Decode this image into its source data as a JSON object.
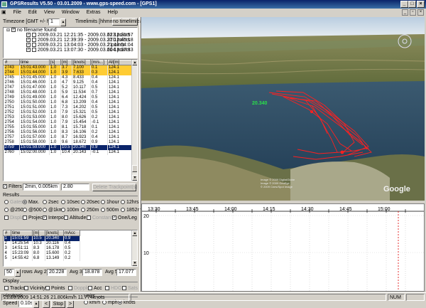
{
  "window": {
    "title": "GPSResults V5.50 - 03.01.2009 - www.gps-speed.com - [GPS1]"
  },
  "menu": [
    "File",
    "Edit",
    "View",
    "Window",
    "Extras",
    "Help"
  ],
  "header": {
    "timezone_label": "Timezone [GMT +/- h]:",
    "timezone_value": "1",
    "timelimits_label": "Timelimits [hhmm]",
    "timelimits_button": "no timelimits"
  },
  "files": {
    "root_label": "no filename found",
    "items": [
      {
        "label": "2009.03.21 12:21:35 - 2009.03.21 12:31:57",
        "points": "623 points"
      },
      {
        "label": "2009.03.21 12:39:39 - 2009.03.21 12:45:18",
        "points": "370 points"
      },
      {
        "label": "2009.03.21 13:04:03 - 2009.03.21 13:04:04",
        "points": "2 points"
      },
      {
        "label": "2009.03.21 13:07:30 - 2009.03.21 13:17:33",
        "points": "604 points"
      }
    ]
  },
  "points_table": {
    "columns": [
      "#",
      "time",
      "[s]",
      "[m]",
      "[knots]",
      "[m/s...]",
      "Alt[m]"
    ],
    "rows": [
      {
        "n": "2743",
        "time": "15:01:43.000",
        "s": "1.0",
        "m": "3.7",
        "kn": "7.100",
        "ms": "0.1",
        "alt": "124.1",
        "state": "hl"
      },
      {
        "n": "2744",
        "time": "15:01:44.000",
        "s": "1.0",
        "m": "3.9",
        "kn": "7.633",
        "ms": "0.3",
        "alt": "124.1",
        "state": "hl"
      },
      {
        "n": "2745",
        "time": "15:01:45.000",
        "s": "1.0",
        "m": "4.3",
        "kn": "8.433",
        "ms": "0.4",
        "alt": "124.1",
        "state": ""
      },
      {
        "n": "2746",
        "time": "15:01:46.000",
        "s": "1.0",
        "m": "4.7",
        "kn": "9.125",
        "ms": "0.4",
        "alt": "124.1",
        "state": ""
      },
      {
        "n": "2747",
        "time": "15:01:47.000",
        "s": "1.0",
        "m": "5.2",
        "kn": "10.117",
        "ms": "0.5",
        "alt": "124.1",
        "state": ""
      },
      {
        "n": "2748",
        "time": "15:01:48.000",
        "s": "1.0",
        "m": "5.9",
        "kn": "11.534",
        "ms": "0.7",
        "alt": "124.1",
        "state": ""
      },
      {
        "n": "2749",
        "time": "15:01:49.000",
        "s": "1.0",
        "m": "6.4",
        "kn": "12.424",
        "ms": "0.5",
        "alt": "124.1",
        "state": ""
      },
      {
        "n": "2750",
        "time": "15:01:50.000",
        "s": "1.0",
        "m": "6.8",
        "kn": "13.209",
        "ms": "0.4",
        "alt": "124.1",
        "state": ""
      },
      {
        "n": "2751",
        "time": "15:01:51.000",
        "s": "1.0",
        "m": "7.3",
        "kn": "14.202",
        "ms": "0.5",
        "alt": "124.1",
        "state": ""
      },
      {
        "n": "2752",
        "time": "15:01:52.000",
        "s": "1.0",
        "m": "7.9",
        "kn": "15.321",
        "ms": "0.5",
        "alt": "124.1",
        "state": ""
      },
      {
        "n": "2753",
        "time": "15:01:53.000",
        "s": "1.0",
        "m": "8.0",
        "kn": "15.626",
        "ms": "0.2",
        "alt": "124.1",
        "state": ""
      },
      {
        "n": "2754",
        "time": "15:01:54.000",
        "s": "1.0",
        "m": "7.9",
        "kn": "15.454",
        "ms": "-0.1",
        "alt": "124.1",
        "state": ""
      },
      {
        "n": "2755",
        "time": "15:01:55.000",
        "s": "1.0",
        "m": "8.1",
        "kn": "15.718",
        "ms": "0.1",
        "alt": "124.1",
        "state": ""
      },
      {
        "n": "2756",
        "time": "15:01:56.000",
        "s": "1.0",
        "m": "8.3",
        "kn": "16.106",
        "ms": "0.2",
        "alt": "124.1",
        "state": ""
      },
      {
        "n": "2757",
        "time": "15:01:57.000",
        "s": "1.0",
        "m": "8.7",
        "kn": "16.923",
        "ms": "0.4",
        "alt": "124.1",
        "state": ""
      },
      {
        "n": "2758",
        "time": "15:01:58.000",
        "s": "1.0",
        "m": "9.6",
        "kn": "18.672",
        "ms": "0.9",
        "alt": "124.1",
        "state": ""
      },
      {
        "n": "2759",
        "time": "15:01:59.000",
        "s": "1.0",
        "m": "10.5",
        "kn": "20.340",
        "ms": "0.9",
        "alt": "124.1",
        "state": "sel"
      },
      {
        "n": "2760",
        "time": "15:02:00.000",
        "s": "1.0",
        "m": "10.4",
        "kn": "20.143",
        "ms": "-0.1",
        "alt": "124.1",
        "state": ""
      }
    ]
  },
  "filters": {
    "label": "Filters",
    "value": "2min, 0.005km",
    "value2": "2.80",
    "delete_button": "Delete Trackpoint(s)"
  },
  "results": {
    "title": "Results",
    "row1": [
      "Gates",
      "Max.",
      "2sec",
      "10sec",
      "20sec",
      "1hour",
      "12hrs"
    ],
    "row2": [
      "@250",
      "@500",
      "@1km",
      "100m",
      "250m",
      "500m",
      "1852m"
    ],
    "row3": [
      "Display",
      "Project",
      "Interpol",
      "Altitude",
      "Constant",
      "One/Leg"
    ]
  },
  "results_table": {
    "columns": [
      "#",
      "time",
      "[m]",
      "[knots]",
      "mAcc"
    ],
    "rows": [
      {
        "n": "1",
        "time": "15:01:59",
        "m": "10.5",
        "kn": "20.340",
        "acc": "0.9",
        "state": "sel"
      },
      {
        "n": "2",
        "time": "14:25:54",
        "m": "10.3",
        "kn": "20.116",
        "acc": "0.4",
        "state": ""
      },
      {
        "n": "3",
        "time": "14:51:11",
        "m": "8.3",
        "kn": "16.178",
        "acc": "0.5",
        "state": ""
      },
      {
        "n": "4",
        "time": "15:23:09",
        "m": "8.0",
        "kn": "15.600",
        "acc": "0.2",
        "state": ""
      },
      {
        "n": "5",
        "time": "14:55:42",
        "m": "6.8",
        "kn": "13.149",
        "acc": "0.2",
        "state": ""
      }
    ]
  },
  "rows_bar": {
    "rows_value": "50",
    "rows_label": "rows",
    "avg2_label": "Avg 2:",
    "avg2_value": "20.228",
    "avg3_label": "Avg 3:",
    "avg3_value": "18.878",
    "avg5_label": "Avg 5:",
    "avg5_value": "17.077"
  },
  "display": {
    "title": "Display",
    "options": [
      "Tracks",
      "Vicinity",
      "Points",
      "Doppler",
      "Acc",
      "HDOP",
      "Sats"
    ]
  },
  "playback": {
    "title": "Playback",
    "speed_label": "Speed",
    "speed_value": "0.10s",
    "prev": "<",
    "stop": "Stop",
    "next": ">"
  },
  "units": {
    "title": "Units",
    "options": [
      "km/h",
      "mph",
      "knots"
    ]
  },
  "map": {
    "speed_label": "20.340",
    "google_label": "Google",
    "credit_lines": [
      "Image © 2009 DigitalGlobe",
      "Image © 2009 GeoEye",
      "© 2009 Cnes/Spot Image"
    ]
  },
  "chart": {
    "time_ticks": [
      "13:30",
      "13:45",
      "14:00",
      "14:15",
      "14:30",
      "14:45",
      "15:00"
    ],
    "y_ticks": [
      "20",
      "10"
    ]
  },
  "status": {
    "info": "21.03.2009 14:51:26 21.806km/h 11.774knots",
    "num": "NUM"
  }
}
